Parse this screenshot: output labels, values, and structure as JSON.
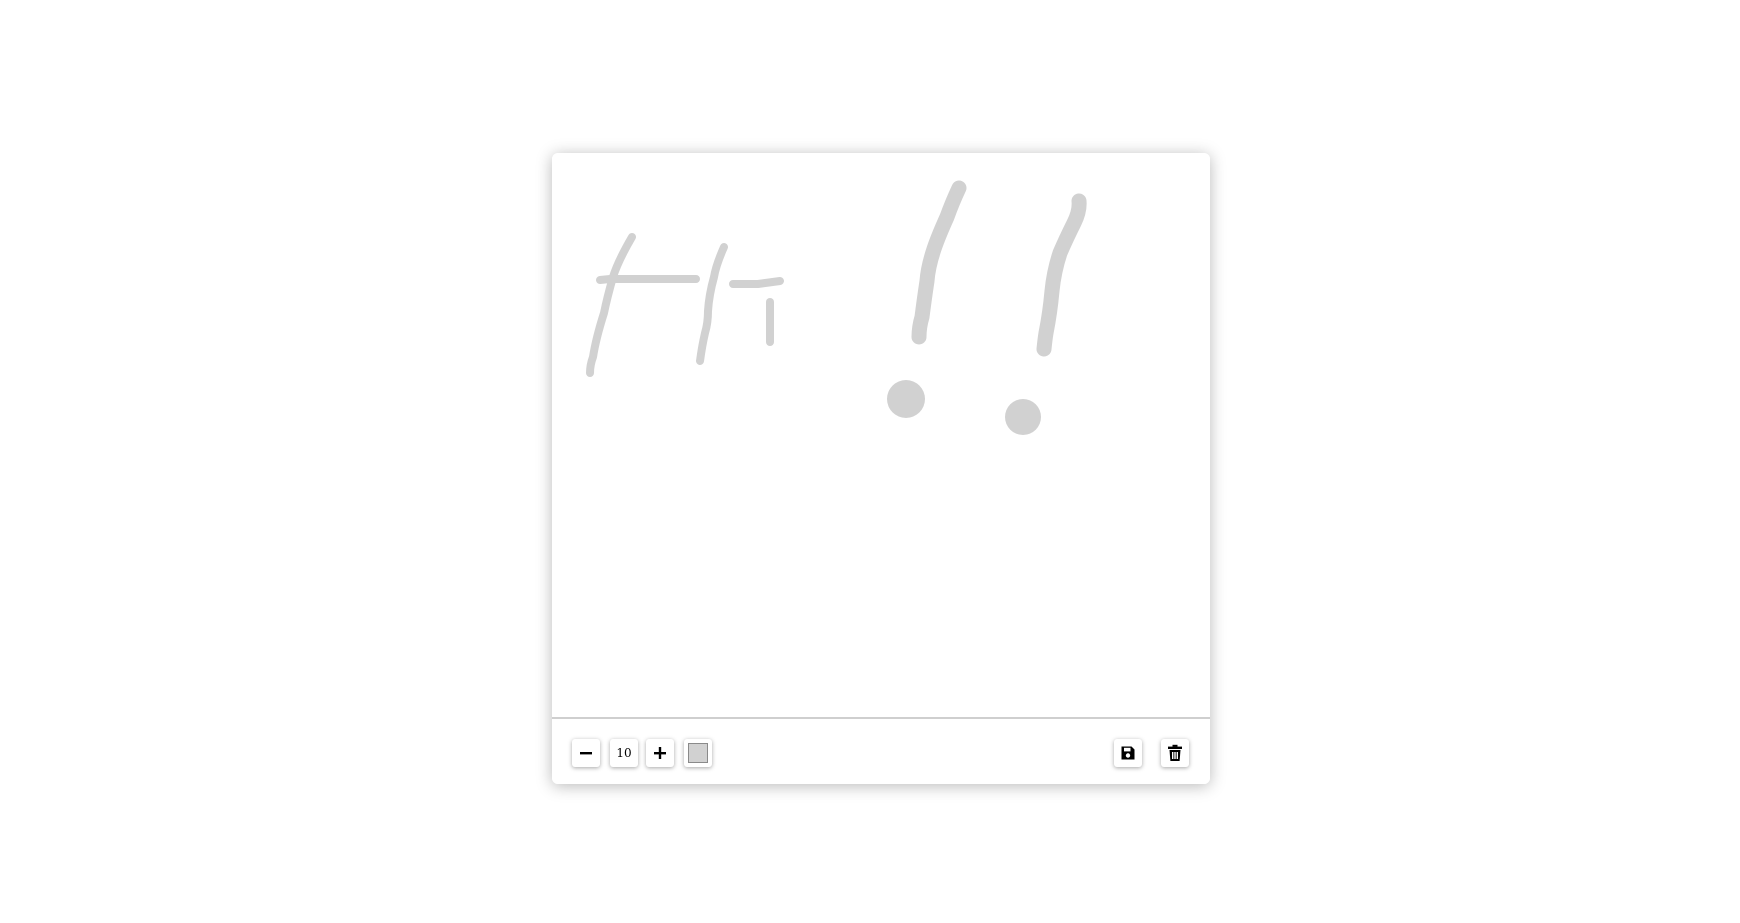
{
  "canvas": {
    "stroke_color": "#d1d1d1",
    "background": "#ffffff"
  },
  "toolbar": {
    "decrease_icon": "minus-icon",
    "brush_size": "10",
    "increase_icon": "plus-icon",
    "current_color": "#d1d1d1",
    "save_icon": "floppy-disk-icon",
    "clear_icon": "trash-icon"
  }
}
